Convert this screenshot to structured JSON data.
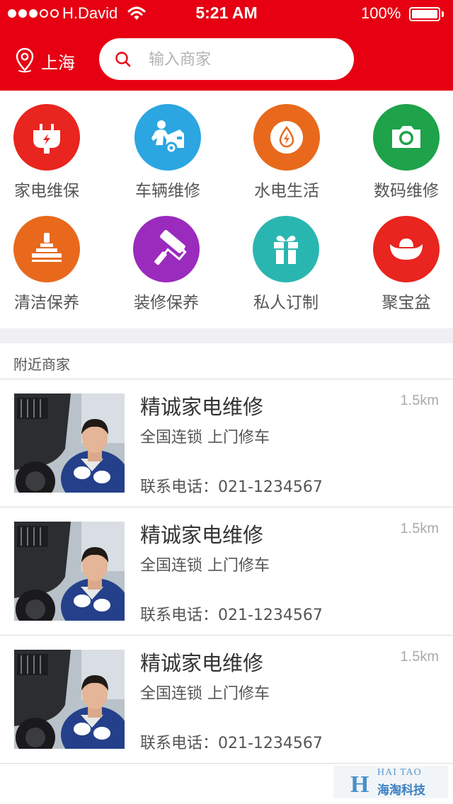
{
  "status_bar": {
    "carrier": "H.David",
    "time": "5:21 AM",
    "battery": "100%"
  },
  "header": {
    "city": "上海",
    "search_placeholder": "输入商家",
    "brand_color": "#e60012"
  },
  "categories": [
    {
      "label": "家电维保",
      "icon": "plug-icon",
      "color": "#e8251e"
    },
    {
      "label": "车辆维修",
      "icon": "car-repair-icon",
      "color": "#2ba6e1"
    },
    {
      "label": "水电生活",
      "icon": "water-electric-icon",
      "color": "#e8691c"
    },
    {
      "label": "数码维修",
      "icon": "camera-icon",
      "color": "#1ea24a"
    },
    {
      "label": "清洁保养",
      "icon": "vacuum-icon",
      "color": "#e8691c"
    },
    {
      "label": "装修保养",
      "icon": "paint-roller-icon",
      "color": "#9b2bbd"
    },
    {
      "label": "私人订制",
      "icon": "gift-icon",
      "color": "#2ab6b0"
    },
    {
      "label": "聚宝盆",
      "icon": "ingot-icon",
      "color": "#e8251e"
    }
  ],
  "nearby": {
    "title": "附近商家",
    "merchants": [
      {
        "name": "精诚家电维修",
        "distance": "1.5km",
        "desc": "全国连锁 上门修车",
        "phone": "联系电话：021-1234567"
      },
      {
        "name": "精诚家电维修",
        "distance": "1.5km",
        "desc": "全国连锁 上门修车",
        "phone": "联系电话：021-1234567"
      },
      {
        "name": "精诚家电维修",
        "distance": "1.5km",
        "desc": "全国连锁 上门修车",
        "phone": "联系电话：021-1234567"
      }
    ]
  },
  "watermark": {
    "letter": "H",
    "en": "HAI TAO",
    "cn": "海淘科技"
  }
}
